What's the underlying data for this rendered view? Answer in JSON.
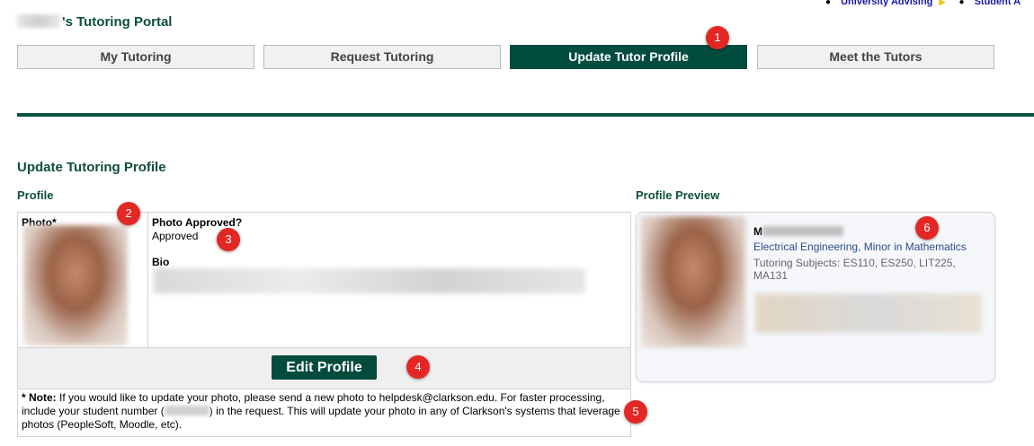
{
  "top_links": {
    "items": [
      {
        "label": "University Advising",
        "arrow": "▶"
      },
      {
        "label": "Student A"
      }
    ]
  },
  "header": {
    "title_suffix": "'s Tutoring Portal"
  },
  "tabs": [
    {
      "label": "My Tutoring",
      "active": false
    },
    {
      "label": "Request Tutoring",
      "active": false
    },
    {
      "label": "Update Tutor Profile",
      "active": true
    },
    {
      "label": "Meet the Tutors",
      "active": false
    }
  ],
  "main": {
    "heading": "Update Tutoring Profile",
    "profile_heading": "Profile",
    "preview_heading": "Profile Preview"
  },
  "profile": {
    "photo_label": "Photo*",
    "photo_approved_label": "Photo Approved?",
    "photo_approved_value": "Approved",
    "bio_label": "Bio",
    "edit_button": "Edit Profile",
    "note_bold": "* Note:",
    "note_text_1": " If you would like to update your photo, please send a new photo to helpdesk@clarkson.edu. For faster processing, include your student number (",
    "note_text_2": ") in the request. This will update your photo in any of Clarkson's systems that leverage photos (PeopleSoft, Moodle, etc)."
  },
  "preview": {
    "name_initial": "M",
    "major": "Electrical Engineering, Minor in Mathematics",
    "subjects": "Tutoring Subjects: ES110, ES250, LIT225, MA131"
  },
  "markers": [
    "1",
    "2",
    "3",
    "4",
    "5",
    "6"
  ],
  "colors": {
    "brand_green": "#004c3f",
    "link_blue": "#1a1aa6",
    "marker_red": "#e32724"
  }
}
